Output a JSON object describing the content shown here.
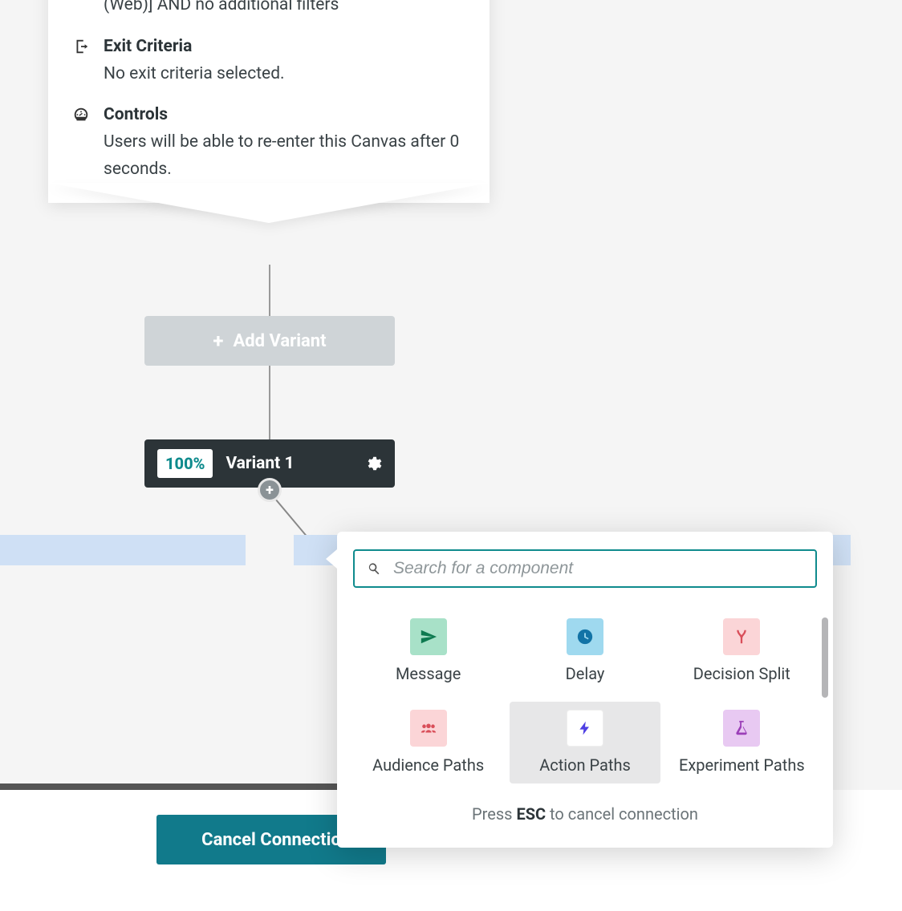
{
  "card": {
    "entry_snippet": "(Web)] AND no additional filters",
    "exit_title": "Exit Criteria",
    "exit_text": "No exit criteria selected.",
    "controls_title": "Controls",
    "controls_text": "Users will be able to re-enter this Canvas after 0 seconds."
  },
  "add_variant_label": "Add Variant",
  "variant": {
    "pct": "100%",
    "name": "Variant 1"
  },
  "search_placeholder": "Search for a component",
  "components": {
    "message": "Message",
    "delay": "Delay",
    "decision_split": "Decision Split",
    "audience_paths": "Audience Paths",
    "action_paths": "Action Paths",
    "experiment_paths": "Experiment Paths"
  },
  "hint_prefix": "Press ",
  "hint_key": "ESC",
  "hint_suffix": " to cancel connection",
  "cancel_button": "Cancel Connectio"
}
